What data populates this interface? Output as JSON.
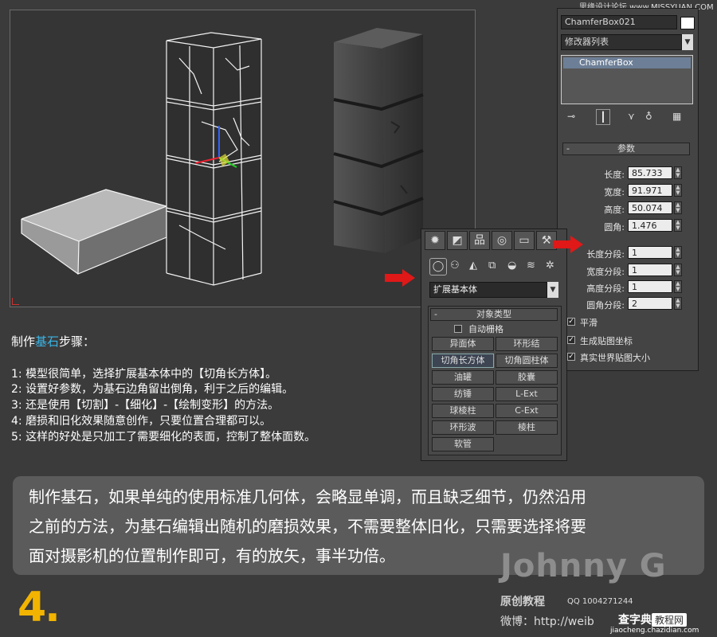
{
  "watermark_top": "思缘设计论坛 www.MISSYUAN.COM",
  "command_panel": {
    "object_name": "ChamferBox021",
    "modifier_list": "修改器列表",
    "stack_item": "ChamferBox",
    "params_title": "参数",
    "params": [
      {
        "label": "长度:",
        "value": "85.733"
      },
      {
        "label": "宽度:",
        "value": "91.971"
      },
      {
        "label": "高度:",
        "value": "50.074"
      },
      {
        "label": "圆角:",
        "value": "1.476"
      },
      {
        "label": "长度分段:",
        "value": "1"
      },
      {
        "label": "宽度分段:",
        "value": "1"
      },
      {
        "label": "高度分段:",
        "value": "1"
      },
      {
        "label": "圆角分段:",
        "value": "2"
      }
    ],
    "checkboxes": [
      {
        "label": "平滑",
        "checked": true
      },
      {
        "label": "生成贴图坐标",
        "checked": true
      },
      {
        "label": "真实世界贴图大小",
        "checked": true
      }
    ]
  },
  "create_panel": {
    "dropdown": "扩展基本体",
    "rollout_title": "对象类型",
    "autogrid": "自动栅格",
    "buttons": [
      "异面体",
      "环形结",
      "切角长方体",
      "切角圆柱体",
      "油罐",
      "胶囊",
      "纺锤",
      "L-Ext",
      "球棱柱",
      "C-Ext",
      "环形波",
      "棱柱",
      "软管"
    ],
    "active_button": "切角长方体"
  },
  "steps": {
    "title_pre": "制作",
    "title_highlight": "基石",
    "title_post": "步骤：",
    "items": [
      "1: 模型很简单，选择扩展基本体中的【切角长方体】。",
      "2: 设置好参数，为基石边角留出倒角，利于之后的编辑。",
      "3: 还是使用【切割】-【细化】-【绘制变形】的方法。",
      "4: 磨损和旧化效果随意创作，只要位置合理都可以。",
      "5: 这样的好处是只加工了需要细化的表面，控制了整体面数。"
    ]
  },
  "summary_lines": [
    "制作基石，如果单纯的使用标准几何体，会略显单调，而且缺乏细节，仍然沿用",
    "之前的方法，为基石编辑出随机的磨损效果，不需要整体旧化，只需要选择将要",
    "面对摄影机的位置制作即可，有的放矢，事半功倍。"
  ],
  "step_number": "4.",
  "brand": {
    "name": "Johnny G",
    "sub": "原创教程",
    "qq": "QQ 1004271244",
    "weibo": "微博：http://weib"
  },
  "watermark_bottom": {
    "logo": "查字典",
    "badge": "教程网",
    "url": "jiaocheng.chazidian.com"
  },
  "colors": {
    "highlight": "#3ab4e6",
    "step_number": "#f2b400",
    "arrow": "#e01818"
  }
}
